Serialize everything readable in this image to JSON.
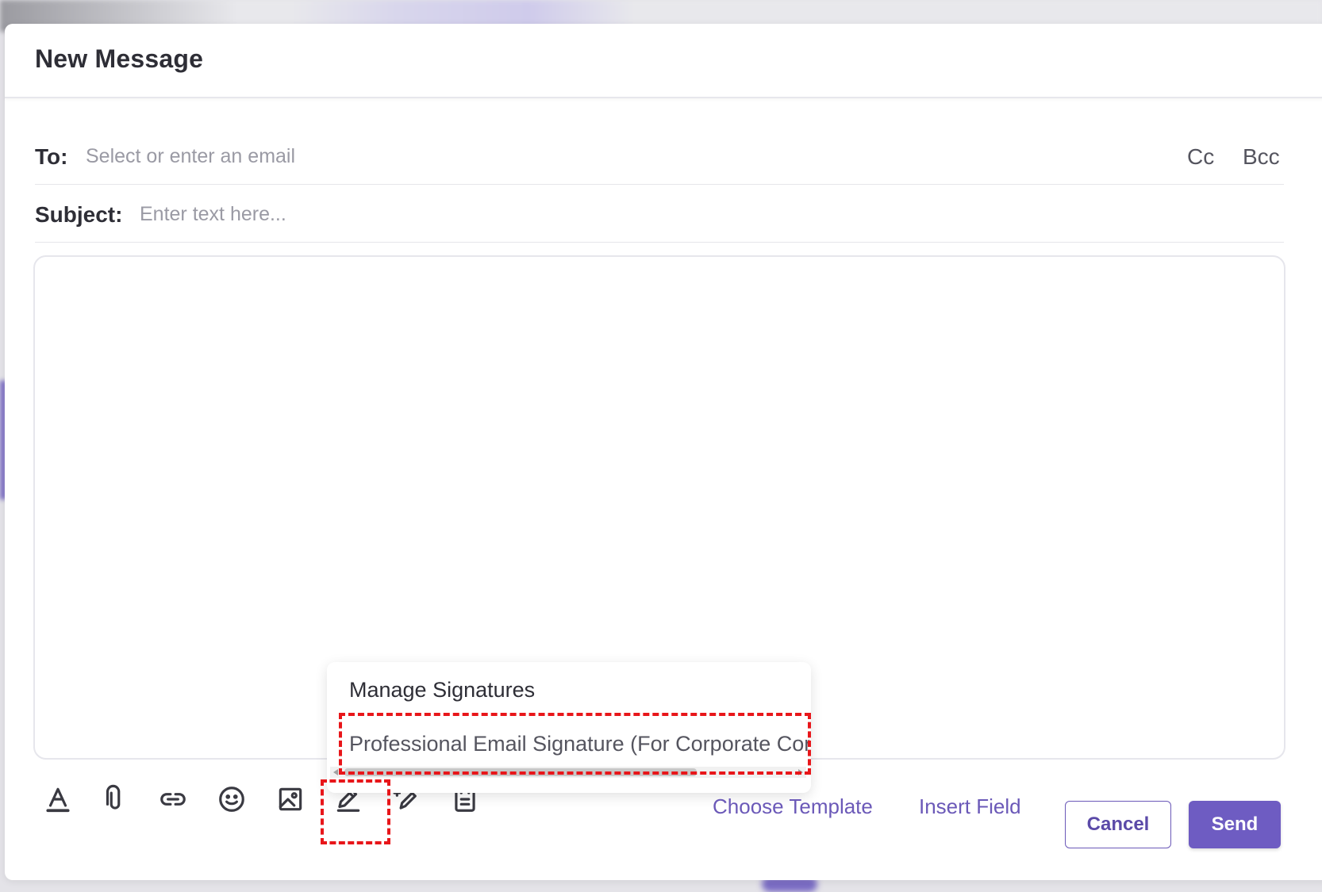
{
  "dialog": {
    "title": "New Message"
  },
  "to": {
    "label": "To:",
    "placeholder": "Select or enter an email",
    "value": ""
  },
  "cc": {
    "label": "Cc"
  },
  "bcc": {
    "label": "Bcc"
  },
  "subject": {
    "label": "Subject:",
    "placeholder": "Enter text here...",
    "value": ""
  },
  "editor": {
    "content": ""
  },
  "toolbar": {
    "icons": [
      "text-format-icon",
      "attachment-icon",
      "link-icon",
      "emoji-icon",
      "image-icon",
      "signature-pen-icon",
      "ai-magic-pen-icon",
      "clipboard-icon"
    ]
  },
  "signature_menu": {
    "manage_label": "Manage Signatures",
    "items": [
      "Professional Email Signature (For Corporate Cor"
    ]
  },
  "actions": {
    "choose_template": "Choose Template",
    "insert_field": "Insert Field",
    "cancel": "Cancel",
    "send": "Send"
  },
  "colors": {
    "accent": "#6e5cc2",
    "highlight": "#e8161a"
  }
}
